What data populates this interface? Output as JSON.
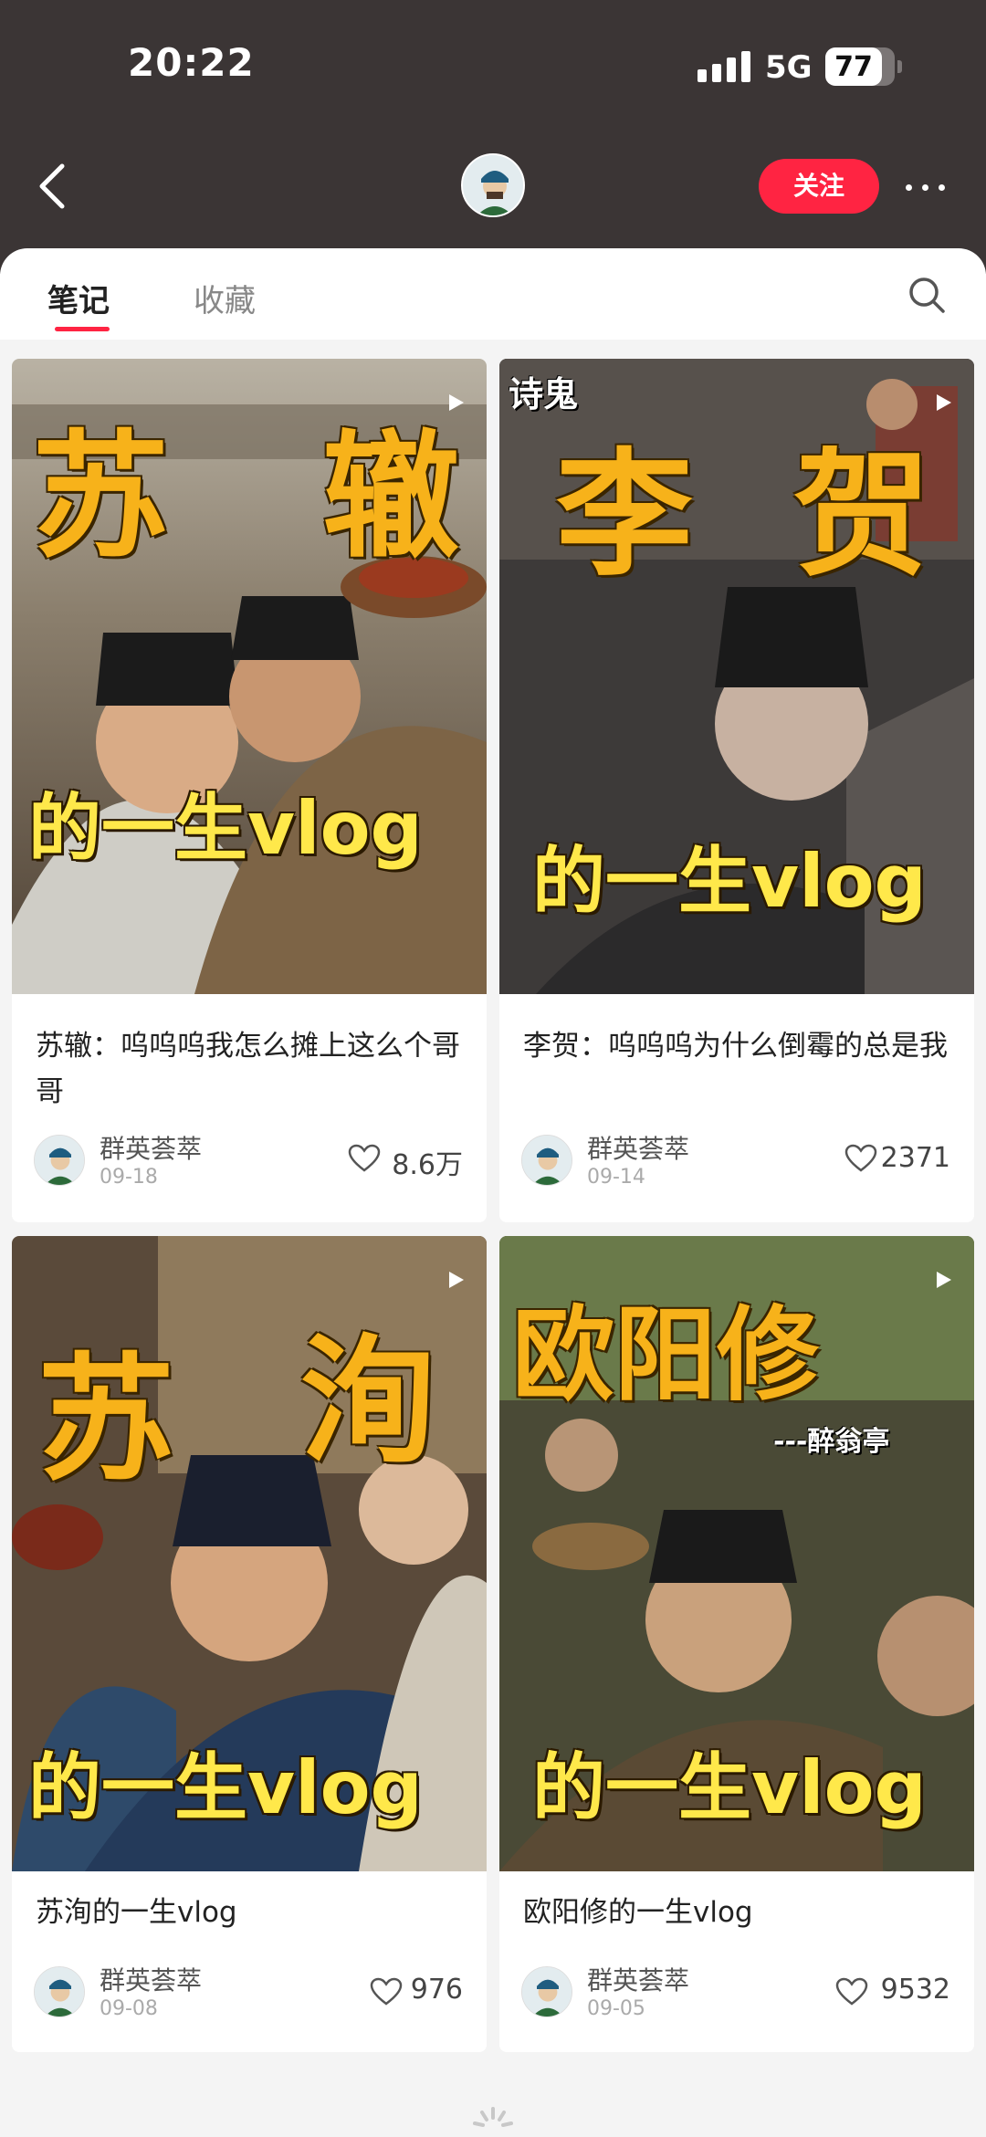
{
  "status": {
    "time": "20:22",
    "network": "5G",
    "battery": "77"
  },
  "header": {
    "follow_label": "关注"
  },
  "tabs": [
    {
      "label": "笔记",
      "active": true
    },
    {
      "label": "收藏",
      "active": false
    }
  ],
  "colors": {
    "accent": "#ff2442",
    "topbar": "#3b3535",
    "headline": "#f7b21a",
    "subline": "#ffe84a"
  },
  "icons": {
    "back": "chevron-left-icon",
    "more": "more-dots-icon",
    "search": "search-icon",
    "like": "heart-icon",
    "video": "play-icon",
    "loading": "spinner-icon"
  },
  "notes": [
    {
      "cover_headline": [
        "苏",
        "辙"
      ],
      "cover_subline": "的一生vlog",
      "title": "苏辙：呜呜呜我怎么摊上这么个哥哥",
      "author": "群英荟萃",
      "date": "09-18",
      "likes": "8.6万"
    },
    {
      "cover_tag": "诗鬼",
      "cover_headline": [
        "李",
        "贺"
      ],
      "cover_subline": "的一生vlog",
      "title": "李贺：呜呜呜为什么倒霉的总是我",
      "author": "群英荟萃",
      "date": "09-14",
      "likes": "2371"
    },
    {
      "cover_headline": [
        "苏",
        "洵"
      ],
      "cover_subline": "的一生vlog",
      "title": "苏洵的一生vlog",
      "author": "群英荟萃",
      "date": "09-08",
      "likes": "976"
    },
    {
      "cover_headline": [
        "欧阳修"
      ],
      "cover_tag": "---醉翁亭",
      "cover_subline": "的一生vlog",
      "title": "欧阳修的一生vlog",
      "author": "群英荟萃",
      "date": "09-05",
      "likes": "9532"
    }
  ]
}
